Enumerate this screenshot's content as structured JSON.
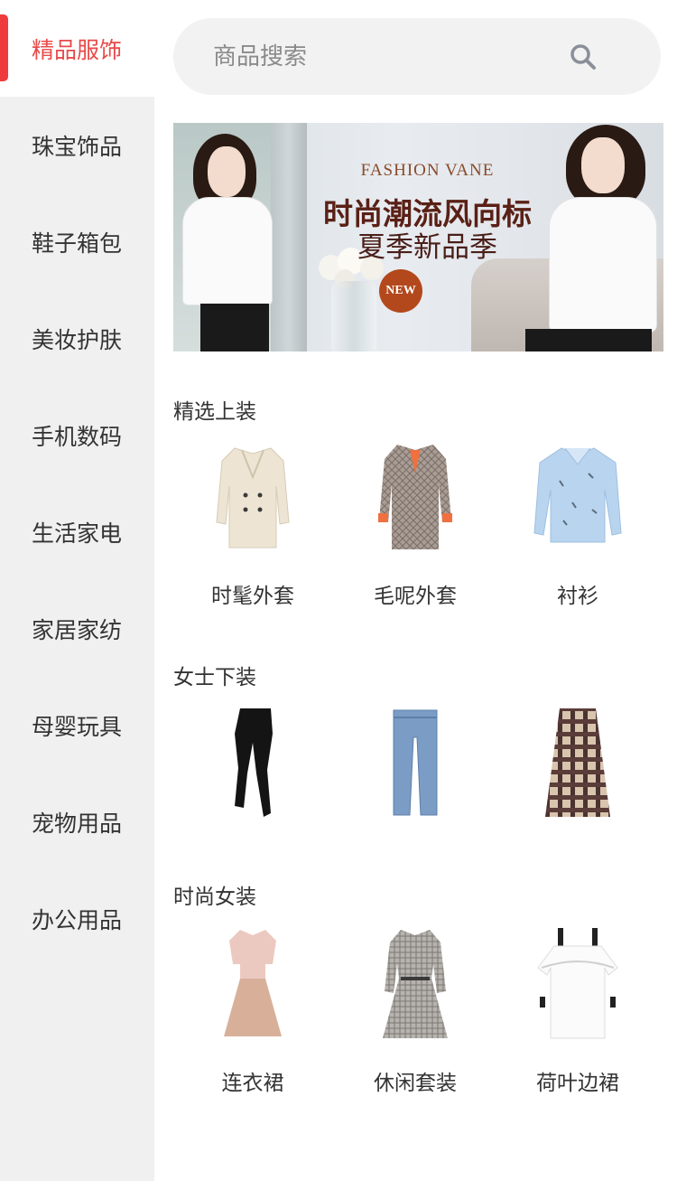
{
  "sidebar": {
    "items": [
      {
        "label": "精品服饰",
        "active": true
      },
      {
        "label": "珠宝饰品"
      },
      {
        "label": "鞋子箱包"
      },
      {
        "label": "美妆护肤"
      },
      {
        "label": "手机数码"
      },
      {
        "label": "生活家电"
      },
      {
        "label": "家居家纺"
      },
      {
        "label": "母婴玩具"
      },
      {
        "label": "宠物用品"
      },
      {
        "label": "办公用品"
      }
    ]
  },
  "search": {
    "placeholder": "商品搜索",
    "icon": "search-icon"
  },
  "banner": {
    "title_en": "FASHION VANE",
    "title_main": "时尚潮流风向标",
    "title_sub": "夏季新品季",
    "badge": "NEW"
  },
  "sections": [
    {
      "title": "精选上装",
      "products": [
        {
          "label": "时髦外套",
          "icon": "beige-coat-image"
        },
        {
          "label": "毛呢外套",
          "icon": "plaid-coat-image"
        },
        {
          "label": "衬衫",
          "icon": "blue-shirt-image"
        }
      ]
    },
    {
      "title": "女士下装",
      "products": [
        {
          "label": "",
          "icon": "black-leggings-image"
        },
        {
          "label": "",
          "icon": "jeans-image"
        },
        {
          "label": "",
          "icon": "plaid-skirt-image"
        }
      ]
    },
    {
      "title": "时尚女装",
      "products": [
        {
          "label": "连衣裙",
          "icon": "pink-dress-image"
        },
        {
          "label": "休闲套装",
          "icon": "plaid-dress-image"
        },
        {
          "label": "荷叶边裙",
          "icon": "white-dress-image"
        }
      ]
    }
  ],
  "colors": {
    "accent": "#ef3b3b",
    "sidebar_bg": "#f0f0f0",
    "search_bg": "#f2f2f2"
  }
}
